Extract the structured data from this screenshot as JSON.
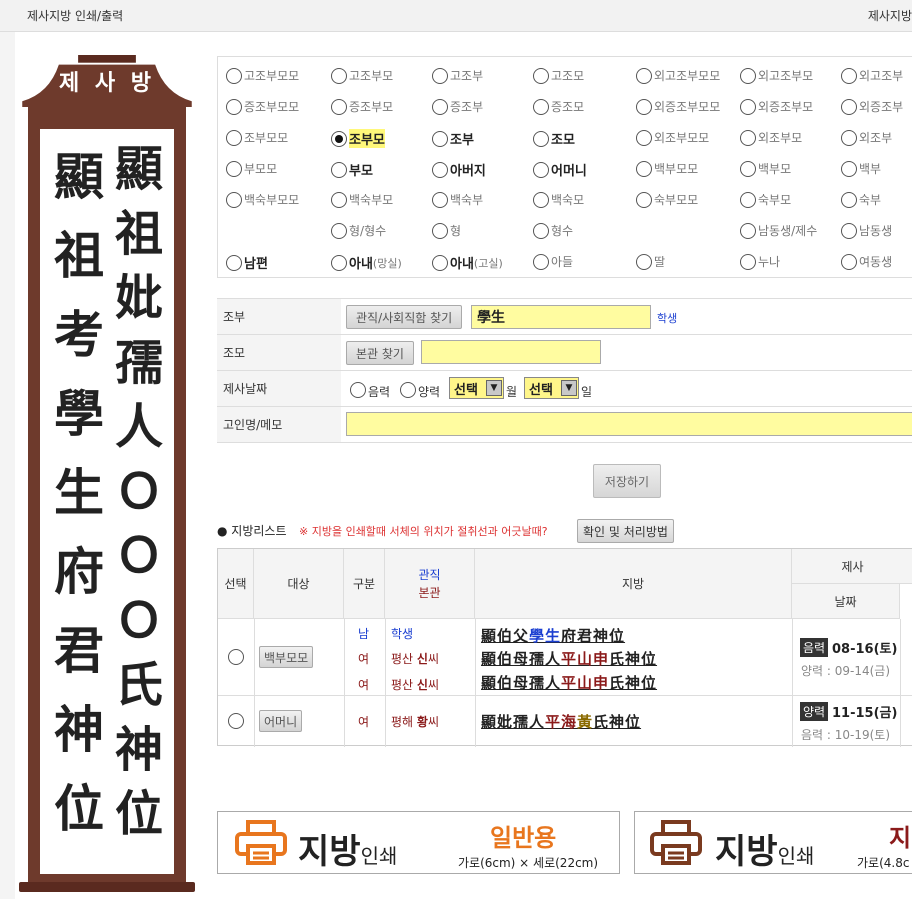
{
  "header": {
    "title": "제사지방 인쇄/출력",
    "right_text": "제사지방"
  },
  "jibang": {
    "caption": "제 사 방",
    "right_column": [
      "顯",
      "祖",
      "妣",
      "孺",
      "人",
      "Ｏ",
      "Ｏ",
      "Ｏ",
      "氏",
      "神",
      "位"
    ],
    "left_column": [
      "顯",
      "祖",
      "考",
      "學",
      "生",
      "府",
      "君",
      "神",
      "位"
    ]
  },
  "relations": {
    "rows": [
      [
        {
          "label": "고조부모모"
        },
        {
          "label": "고조부모"
        },
        {
          "label": "고조부"
        },
        {
          "label": "고조모"
        },
        {
          "label": "외고조부모모"
        },
        {
          "label": "외고조부모"
        },
        {
          "label": "외고조부"
        }
      ],
      [
        {
          "label": "증조부모모"
        },
        {
          "label": "증조부모"
        },
        {
          "label": "증조부"
        },
        {
          "label": "증조모"
        },
        {
          "label": "외증조부모모"
        },
        {
          "label": "외증조부모"
        },
        {
          "label": "외증조부"
        }
      ],
      [
        {
          "label": "조부모모"
        },
        {
          "label": "조부모",
          "selected": true,
          "bold": true
        },
        {
          "label": "조부",
          "bold": true
        },
        {
          "label": "조모",
          "bold": true
        },
        {
          "label": "외조부모모"
        },
        {
          "label": "외조부모"
        },
        {
          "label": "외조부"
        }
      ],
      [
        {
          "label": "부모모"
        },
        {
          "label": "부모",
          "bold": true
        },
        {
          "label": "아버지",
          "bold": true
        },
        {
          "label": "어머니",
          "bold": true
        },
        {
          "label": "백부모모"
        },
        {
          "label": "백부모"
        },
        {
          "label": "백부"
        }
      ],
      [
        {
          "label": "백숙부모모"
        },
        {
          "label": "백숙부모"
        },
        {
          "label": "백숙부"
        },
        {
          "label": "백숙모"
        },
        {
          "label": "숙부모모"
        },
        {
          "label": "숙부모"
        },
        {
          "label": "숙부"
        }
      ],
      [
        null,
        {
          "label": "형/형수"
        },
        {
          "label": "형"
        },
        {
          "label": "형수"
        },
        null,
        {
          "label": "남동생/제수"
        },
        {
          "label": "남동생"
        }
      ],
      [
        {
          "label": "남편",
          "bold": true
        },
        {
          "label": "아내",
          "bold": true,
          "suffix": "(망실)"
        },
        {
          "label": "아내",
          "bold": true,
          "suffix": "(고실)"
        },
        {
          "label": "아들"
        },
        {
          "label": "딸"
        },
        {
          "label": "누나"
        },
        {
          "label": "여동생"
        }
      ]
    ]
  },
  "form": {
    "row1": {
      "label": "조부",
      "button": "관직/사회직함 찾기",
      "value": "學生",
      "hint": "학생"
    },
    "row2": {
      "label": "조모",
      "button": "본관 찾기",
      "value": ""
    },
    "row3": {
      "label": "제사날짜",
      "lunar": "음력",
      "solar": "양력",
      "month_select": "선택",
      "month_unit": "월",
      "day_select": "선택",
      "day_unit": "일"
    },
    "row4": {
      "label": "고인명/메모",
      "value": ""
    },
    "save": "저장하기"
  },
  "list": {
    "title": "● 지방리스트",
    "note": "※ 지방을 인쇄할때 서체의 위치가 절취선과 어긋날때?",
    "note_button": "확인 및 처리방법",
    "headers": {
      "select": "선택",
      "target": "대상",
      "type": "구분",
      "office1": "관직",
      "office2": "본관",
      "jibang": "지방",
      "jesa": "제사",
      "date": "날짜"
    },
    "rows": [
      {
        "target": "백부모모",
        "lines": [
          {
            "type": "남",
            "office": "학생",
            "surname": "",
            "text": "顯伯父學生府君神位"
          },
          {
            "type": "여",
            "office": "평산",
            "surname": "신",
            "suffix": "씨",
            "text": "顯伯母孺人平山申氏神位"
          },
          {
            "type": "여",
            "office": "평산",
            "surname": "신",
            "suffix": "씨",
            "text": "顯伯母孺人平山申氏神位"
          }
        ],
        "cal": "음력",
        "date": "08-16(토)",
        "sub": "양력 : 09-14(금)"
      },
      {
        "target": "어머니",
        "lines": [
          {
            "type": "여",
            "office": "평해",
            "surname": "황",
            "suffix": "씨",
            "text": "顯妣孺人平海黃氏神位"
          }
        ],
        "cal": "양력",
        "date": "11-15(금)",
        "sub": "음력 : 10-19(토)"
      }
    ]
  },
  "banners": [
    {
      "title": "지방",
      "title_small": "인쇄",
      "tag": "일반용",
      "size": "가로(6cm) × 세로(22cm)"
    },
    {
      "title": "지방",
      "title_small": "인쇄",
      "tag": "지방",
      "size": "가로(4.8c"
    }
  ],
  "colors": {
    "frame": "#6e3a2c",
    "highlight": "#fffca0",
    "printer_orange": "#e8761e",
    "printer_brown": "#7a3a1f"
  }
}
